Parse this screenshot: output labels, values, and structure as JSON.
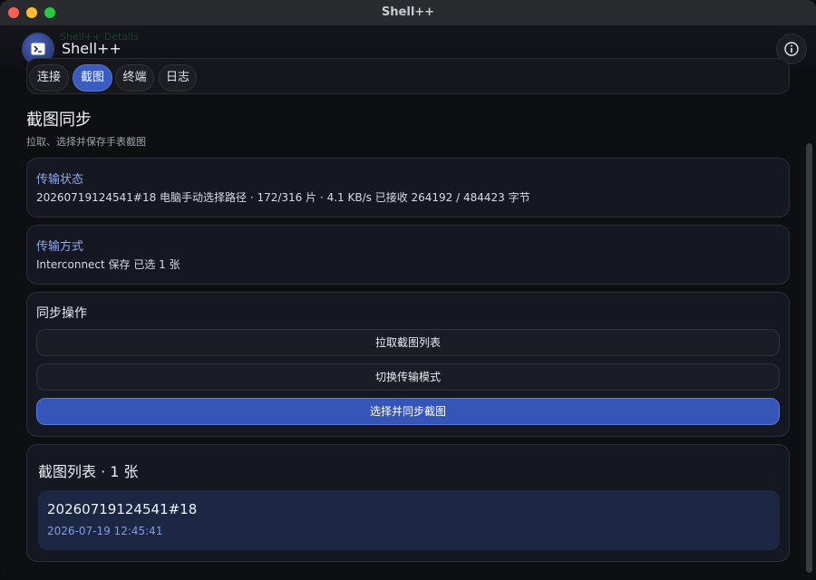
{
  "window": {
    "title": "Shell++"
  },
  "header": {
    "app_name": "Shell++",
    "ghost_text": "Shell++ Details"
  },
  "tabs": [
    {
      "label": "连接",
      "active": false
    },
    {
      "label": "截图",
      "active": true
    },
    {
      "label": "终端",
      "active": false
    },
    {
      "label": "日志",
      "active": false
    }
  ],
  "page": {
    "title": "截图同步",
    "subtitle": "拉取、选择并保存手表截图"
  },
  "transfer_status": {
    "label": "传输状态",
    "value": "20260719124541#18 电脑手动选择路径 · 172/316 片 · 4.1 KB/s 已接收 264192 / 484423 字节"
  },
  "transfer_mode": {
    "label": "传输方式",
    "value": "Interconnect 保存 已选 1 张"
  },
  "sync_actions": {
    "title": "同步操作",
    "fetch_list": "拉取截图列表",
    "switch_mode": "切换传输模式",
    "select_sync": "选择并同步截图"
  },
  "screenshot_list": {
    "title": "截图列表 · 1 张",
    "items": [
      {
        "name": "20260719124541#18",
        "time": "2026-07-19 12:45:41"
      }
    ]
  },
  "colors": {
    "accent": "#3a5bc0",
    "label_blue": "#8ea8f0",
    "background": "#0e0f13"
  },
  "icons": {
    "app": "terminal-icon",
    "info": "info-icon"
  }
}
